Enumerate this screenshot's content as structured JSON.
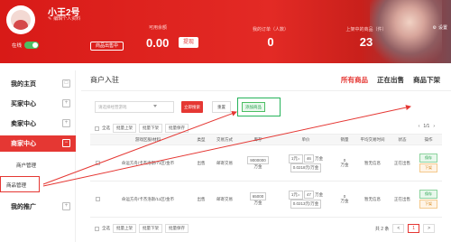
{
  "header": {
    "username": "小王2号",
    "bio": "编辑个人资料",
    "online_label": "在线",
    "items_sold_button": "商品出售中",
    "money_label": "可用余额",
    "money_value": "0.00",
    "withdraw_label": "提现",
    "stats": [
      {
        "label": "我的订单（人数）",
        "value": "0"
      },
      {
        "label": "上架中的商品（件）",
        "value": "23"
      }
    ],
    "settings_label": "设置"
  },
  "sidebar": {
    "items": [
      {
        "label": "我的主页",
        "badge": "□"
      },
      {
        "label": "买家中心",
        "badge": "+"
      },
      {
        "label": "卖家中心",
        "badge": "+"
      },
      {
        "label": "商家中心",
        "badge": "−"
      },
      {
        "label": "商户管理"
      },
      {
        "label": "商品管理"
      },
      {
        "label": "我的推广",
        "badge": "+"
      }
    ]
  },
  "main": {
    "title": "商户入驻",
    "tabs": [
      "所有商品",
      "正在出售",
      "商品下架"
    ],
    "search_placeholder": "请选择经营游戏",
    "search_button": "立即搜索",
    "reset_button": "重置",
    "add_button": "添加商品",
    "toolbar": {
      "select_all": "全选",
      "batch_up": "批量上架",
      "batch_down": "批量下架",
      "batch_save": "批量保存"
    },
    "mini_pager": "1/1",
    "columns": [
      "游戏区服/材料",
      "类型",
      "交易方式",
      "库存",
      "单价",
      "销量",
      "平均交易时间",
      "状态",
      "操作"
    ],
    "rows": [
      {
        "game": "命运方舟/卡杰洛斯/71区/金币",
        "type": "出售",
        "trade": "邮寄交易",
        "stock": "9000000",
        "stock_unit": "万金",
        "price_prefix": "1元=",
        "price_val": "46",
        "price_unit": "万金",
        "price_sub": "0.0218元/万金",
        "sales": "0",
        "sales_unit": "万金",
        "avg_time": "暂无信息",
        "status": "正在出售",
        "ops": [
          "保存",
          "下架"
        ]
      },
      {
        "game": "命运方舟/卡杰洛斯/11区/金币",
        "type": "出售",
        "trade": "邮寄交易",
        "stock": "65000",
        "stock_unit": "万金",
        "price_prefix": "1元=",
        "price_val": "47",
        "price_unit": "万金",
        "price_sub": "0.0213元/万金",
        "sales": "0",
        "sales_unit": "万金",
        "avg_time": "暂无信息",
        "status": "正在出售",
        "ops": [
          "保存",
          "下架"
        ]
      }
    ],
    "pagination": {
      "total": "共 2 条",
      "prev": "<",
      "current": "1",
      "next": ">"
    }
  },
  "colors": {
    "brand_red": "#e53733",
    "add_green": "#26b35a"
  }
}
